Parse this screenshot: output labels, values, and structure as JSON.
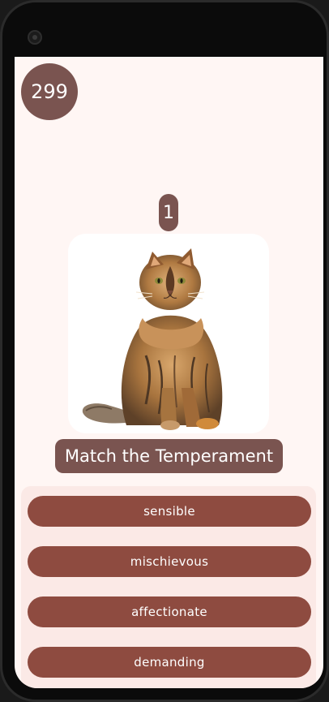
{
  "score": "299",
  "question_number": "1",
  "image_subject": "cat-photo",
  "prompt": "Match the Temperament",
  "options": [
    {
      "label": "sensible"
    },
    {
      "label": "mischievous"
    },
    {
      "label": "affectionate"
    },
    {
      "label": "demanding"
    }
  ],
  "colors": {
    "background": "#fff6f4",
    "badge": "#7a5450",
    "option_button": "#8e4b40",
    "options_panel": "#fbe9e6"
  }
}
